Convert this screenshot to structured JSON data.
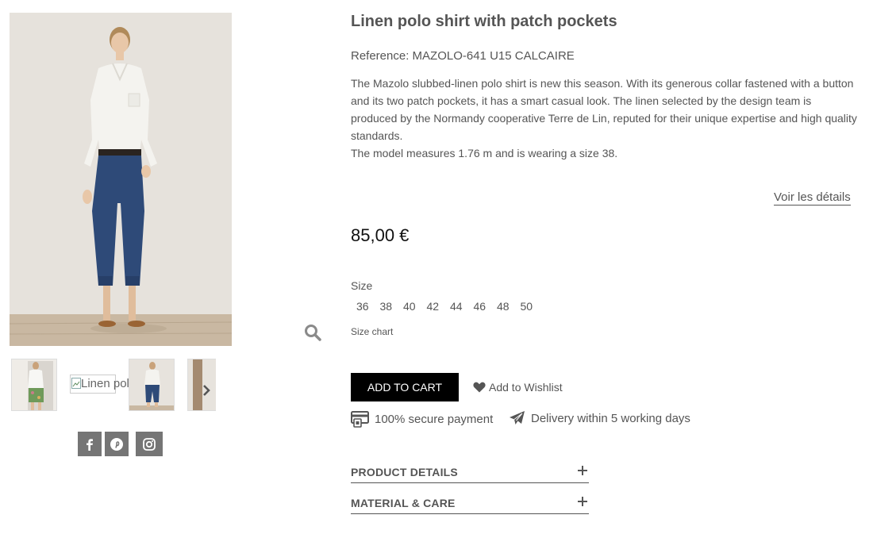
{
  "gallery": {
    "main_image_icon": "model-photo",
    "thumbnails": [
      {
        "icon": "thumb-photo-print-shorts"
      },
      {
        "icon": "broken-image-icon",
        "alt_text": "Linen polo shirt with patch pockets"
      },
      {
        "icon": "thumb-photo-model-front"
      },
      {
        "icon": "thumb-photo-partial"
      }
    ],
    "next_icon": "chevron-right-icon",
    "zoom_icon": "magnifier-icon"
  },
  "social": {
    "items": [
      {
        "name": "facebook",
        "icon": "facebook-icon"
      },
      {
        "name": "pinterest",
        "icon": "pinterest-icon"
      },
      {
        "name": "instagram",
        "icon": "instagram-icon"
      }
    ],
    "color": "#757575"
  },
  "product": {
    "title": "Linen polo shirt with patch pockets",
    "reference": "Reference: MAZOLO-641 U15 CALCAIRE",
    "description_lines": [
      "The Mazolo slubbed-linen polo shirt is new this season. With its generous collar fastened with a button and its two patch pockets, it has a smart casual look. The linen selected by the design team is produced by the Normandy cooperative Terre de Lin, reputed for their unique expertise and high quality standards.",
      "The model measures 1.76 m and is wearing a size 38."
    ],
    "details_link": "Voir les détails",
    "price": "85,00 €"
  },
  "size": {
    "label": "Size",
    "options": [
      "36",
      "38",
      "40",
      "42",
      "44",
      "46",
      "48",
      "50"
    ],
    "chart_link": "Size chart"
  },
  "actions": {
    "add_to_cart": "ADD TO CART",
    "wishlist": "Add to Wishlist",
    "wishlist_icon": "heart-icon"
  },
  "reassurance": [
    {
      "icon": "credit-card-icon",
      "text": "100% secure payment"
    },
    {
      "icon": "paper-plane-icon",
      "text": "Delivery within 5 working days"
    }
  ],
  "accordions": [
    {
      "title": "PRODUCT DETAILS",
      "icon": "plus-icon"
    },
    {
      "title": "MATERIAL & CARE",
      "icon": "plus-icon"
    }
  ],
  "colors": {
    "text": "#555555",
    "button_bg": "#000000",
    "button_text": "#ffffff",
    "social_bg": "#757575",
    "photo_backdrop": "#e4e0da"
  }
}
